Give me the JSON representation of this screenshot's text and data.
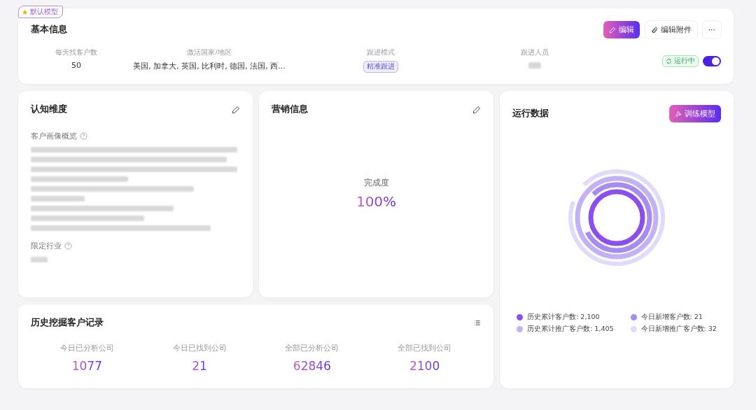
{
  "basic_info": {
    "badge": "默认模型",
    "title": "基本信息",
    "actions": [
      {
        "kind": "primary",
        "label": "编辑"
      },
      {
        "kind": "attach",
        "label": "编辑附件"
      },
      {
        "kind": "more",
        "label": "···"
      }
    ],
    "fields": [
      {
        "label": "每天找客户数",
        "value": "50",
        "kind": "text"
      },
      {
        "label": "激活国家/地区",
        "value": "美国, 加拿大, 英国, 比利时, 德国, 法国, 西...",
        "kind": "text"
      },
      {
        "label": "跟进模式",
        "value": "精准跟进",
        "kind": "tag"
      },
      {
        "label": "跟进人员",
        "kind": "blurred"
      }
    ],
    "status": {
      "label": "运行中",
      "on": true
    }
  },
  "cognition": {
    "title": "认知维度",
    "sections": [
      {
        "label": "客户画像概览"
      },
      {
        "label": "限定行业"
      }
    ]
  },
  "marketing": {
    "title": "营销信息",
    "completion_label": "完成度",
    "completion_value": "100%"
  },
  "history": {
    "title": "历史挖掘客户记录",
    "stats": [
      {
        "label": "今日已分析公司",
        "value": "1077"
      },
      {
        "label": "今日已找到公司",
        "value": "21"
      },
      {
        "label": "全部已分析公司",
        "value": "62846"
      },
      {
        "label": "全部已找到公司",
        "value": "2100"
      }
    ]
  },
  "run_data": {
    "title": "运行数据",
    "button": "训练模型",
    "legend": [
      {
        "label": "历史累计客户数: 2,100",
        "color": "#8b4ff0"
      },
      {
        "label": "今日新增客户数: 21",
        "color": "#a68cf0"
      },
      {
        "label": "历史累计推广客户数: 1,405",
        "color": "#c2b2f5"
      },
      {
        "label": "今日新增推广客户数: 32",
        "color": "#e2daf9"
      }
    ]
  }
}
